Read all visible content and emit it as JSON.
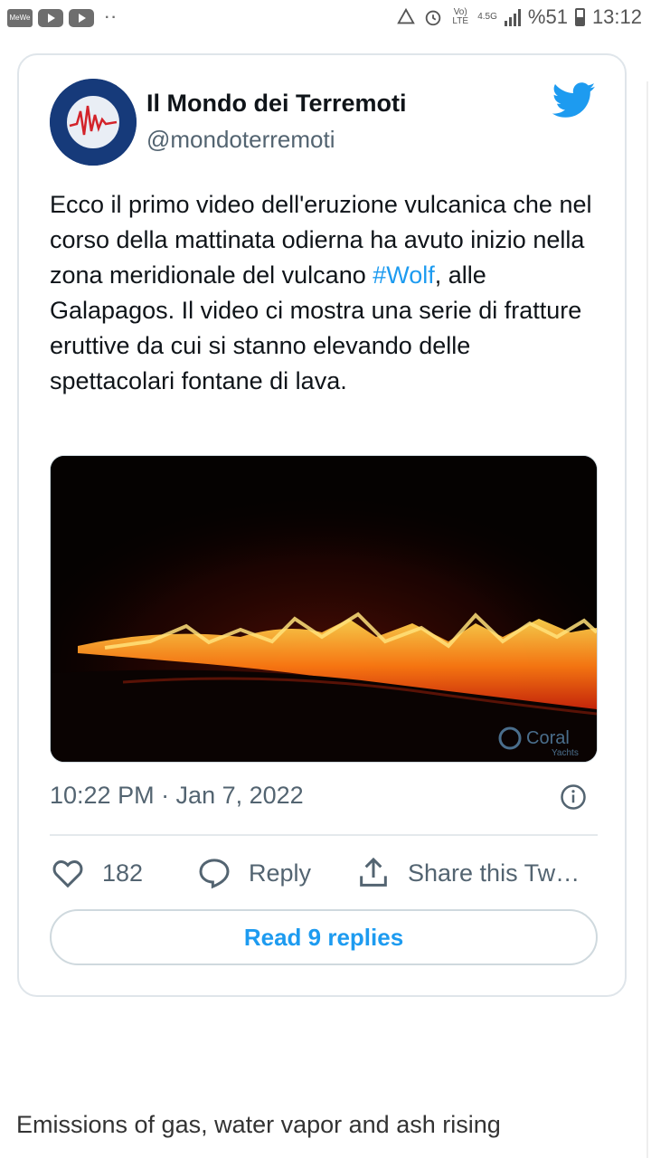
{
  "status_bar": {
    "app_label": "MeWe",
    "network_label": "Vo) LTE",
    "network_type": "4.5G",
    "battery": "%51",
    "time": "13:12"
  },
  "tweet": {
    "author_name": "Il Mondo dei Terremoti",
    "handle": "@mondoterremoti",
    "text_before_hashtag": "Ecco il primo video dell'eruzione vulcanica che nel corso della mattinata odierna ha avuto inizio nella zona meridionale del vulcano ",
    "hashtag": "#Wolf",
    "text_after_hashtag": ", alle Galapagos. Il video ci mostra una serie di fratture eruttive da cui si stanno elevando delle spettacolari fontane di lava.",
    "media_watermark": "Coral",
    "media_watermark_sub": "Yachts",
    "timestamp": "10:22 PM · Jan 7, 2022",
    "like_count": "182",
    "reply_label": "Reply",
    "share_label": "Share this Tw…",
    "read_replies_label": "Read 9 replies"
  },
  "article": {
    "caption": "Emissions of gas, water vapor and ash rising"
  },
  "colors": {
    "accent": "#1d9bf0",
    "muted": "#536471",
    "border": "#cfd9de"
  },
  "icons": [
    "twitter-bird-icon",
    "info-icon",
    "heart-icon",
    "reply-bubble-icon",
    "share-icon"
  ]
}
